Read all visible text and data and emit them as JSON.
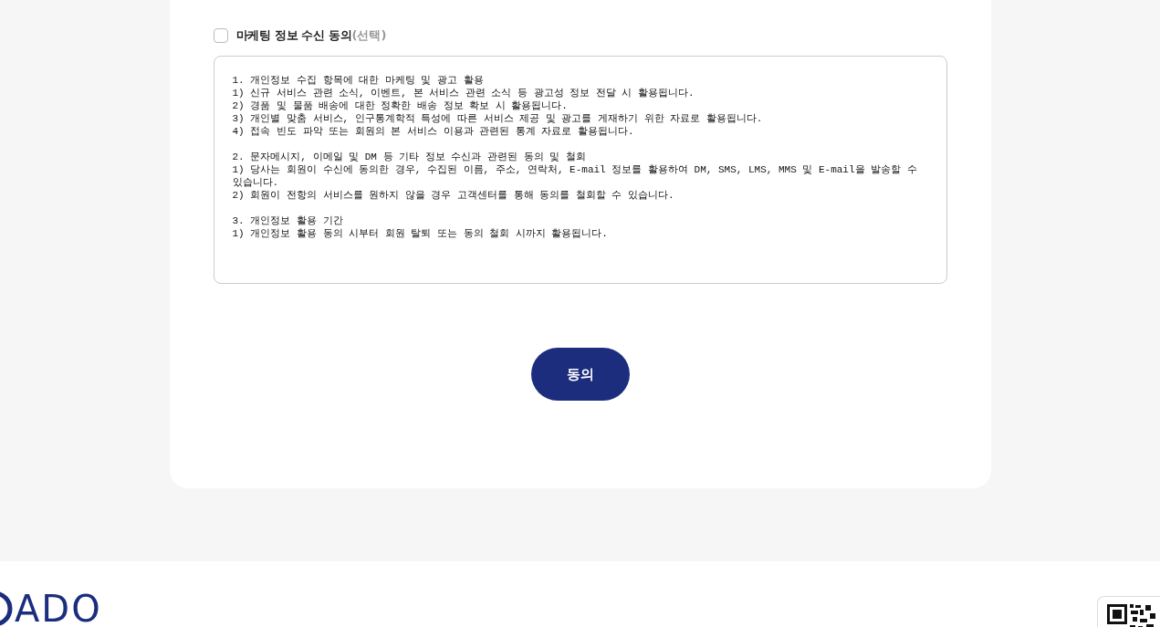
{
  "consent": {
    "label": "마케팅 정보 수신 동의",
    "suffix": "(선택)",
    "checked": false,
    "terms": "1. 개인정보 수집 항목에 대한 마케팅 및 광고 활용\n1) 신규 서비스 관련 소식, 이벤트, 본 서비스 관련 소식 등 광고성 정보 전달 시 활용됩니다.\n2) 경품 및 물품 배송에 대한 정확한 배송 정보 확보 시 활용됩니다.\n3) 개인별 맞춤 서비스, 인구통계학적 특성에 따른 서비스 제공 및 광고를 게재하기 위한 자료로 활용됩니다.\n4) 접속 빈도 파악 또는 회원의 본 서비스 이용과 관련된 통계 자료로 활용됩니다.\n\n2. 문자메시지, 이메일 및 DM 등 기타 정보 수신과 관련된 동의 및 철회\n1) 당사는 회원이 수신에 동의한 경우, 수집된 이름, 주소, 연락처, E-mail 정보를 활용하여 DM, SMS, LMS, MMS 및 E-mail을 발송할 수 있습니다.\n2) 회원이 전항의 서비스를 원하지 않을 경우 고객센터를 통해 동의를 철회할 수 있습니다.\n\n3. 개인정보 활용 기간\n1) 개인정보 활용 동의 시부터 회원 탈퇴 또는 동의 철회 시까지 활용됩니다."
  },
  "button": "동의",
  "footer": {
    "logo": "ADO"
  }
}
